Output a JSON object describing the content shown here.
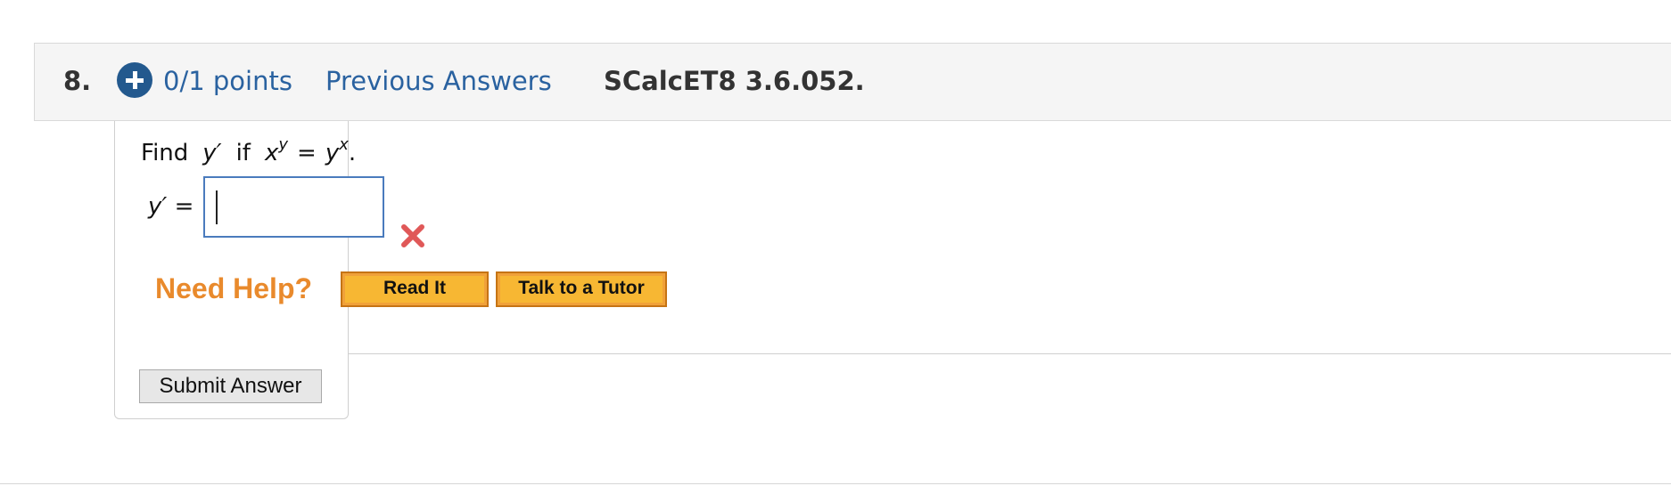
{
  "question": {
    "number": "8.",
    "points": "0/1 points",
    "previous_answers_link": "Previous Answers",
    "reference": "SCalcET8 3.6.052."
  },
  "prompt": {
    "find_word": "Find",
    "y_prime": "y′",
    "if_word": "if",
    "base_x": "x",
    "exp_y": "y",
    "equals": "=",
    "base_y": "y",
    "exp_x": "x",
    "period": "."
  },
  "answer": {
    "label_var": "y′",
    "label_eq": "=",
    "value": "",
    "status": "incorrect",
    "status_icon": "red-x-icon"
  },
  "help": {
    "label": "Need Help?",
    "read_it": "Read It",
    "talk_to_tutor": "Talk to a Tutor"
  },
  "submit_label": "Submit Answer",
  "colors": {
    "header_bg": "#f5f5f5",
    "link_blue": "#2a62a0",
    "plus_icon": "#23598e",
    "help_orange": "#e98a2c",
    "button_gold": "#f7b733",
    "incorrect_red": "#e05858"
  }
}
